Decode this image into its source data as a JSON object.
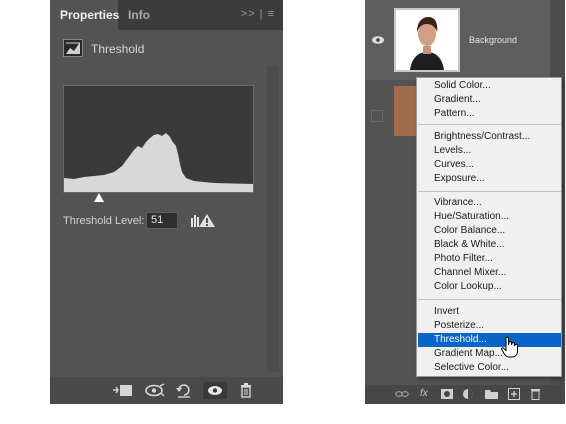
{
  "properties_panel": {
    "tabs": [
      {
        "label": "Properties",
        "active": true
      },
      {
        "label": "Info",
        "active": false
      }
    ],
    "panel_controls": ">> | ≡",
    "adjustment": {
      "title": "Threshold",
      "icon": "threshold-adjustment-icon"
    },
    "threshold_level": {
      "label": "Threshold Level:",
      "value": "51"
    },
    "footer_icons": [
      "clip-to-layer-icon",
      "view-previous-state-icon",
      "reset-icon",
      "toggle-visibility-icon",
      "delete-icon"
    ]
  },
  "layers_panel": {
    "layer": {
      "name": "Background",
      "visible": true
    },
    "footer_icons": [
      "link-icon",
      "fx-icon",
      "add-mask-icon",
      "adjustment-layer-icon",
      "folder-icon",
      "new-layer-icon",
      "trash-icon"
    ],
    "fx_label": "fx"
  },
  "adjustment_menu": {
    "groups": [
      [
        "Solid Color...",
        "Gradient...",
        "Pattern..."
      ],
      [
        "Brightness/Contrast...",
        "Levels...",
        "Curves...",
        "Exposure..."
      ],
      [
        "Vibrance...",
        "Hue/Saturation...",
        "Color Balance...",
        "Black & White...",
        "Photo Filter...",
        "Channel Mixer...",
        "Color Lookup..."
      ],
      [
        "Invert",
        "Posterize...",
        "Threshold...",
        "Gradient Map...",
        "Selective Color..."
      ]
    ],
    "highlighted": "Threshold...",
    "highlight_color": "#0a64c8"
  },
  "colors": {
    "panel_bg": "#535353",
    "tabbar_bg": "#3c3c3c",
    "menu_bg": "#f0f0f0"
  }
}
